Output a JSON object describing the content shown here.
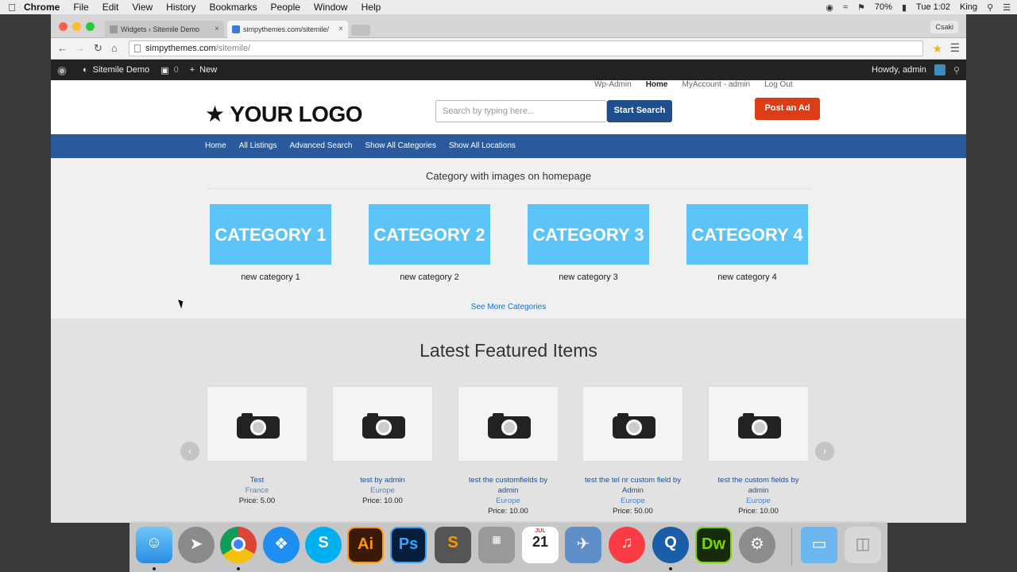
{
  "menubar": {
    "app": "Chrome",
    "items": [
      "File",
      "Edit",
      "View",
      "History",
      "Bookmarks",
      "People",
      "Window",
      "Help"
    ],
    "battery": "70%",
    "clock": "Tue 1:02",
    "user": "King"
  },
  "browser": {
    "tabs": [
      {
        "title": "Widgets ‹ Sitemile Demo",
        "active": false
      },
      {
        "title": "simpythemes.com/sitemile/",
        "active": true
      }
    ],
    "profile": "Csaki",
    "url_host": "simpythemes.com",
    "url_path": "/sitemile/"
  },
  "adminbar": {
    "site": "Sitemile Demo",
    "comments": "0",
    "new": "New",
    "howdy": "Howdy, admin"
  },
  "site": {
    "toplinks": [
      "Wp-Admin",
      "Home",
      "MyAccount - admin",
      "Log Out"
    ],
    "logo": "YOUR LOGO",
    "search_placeholder": "Search by typing here...",
    "search_button": "Start Search",
    "post_button": "Post an Ad",
    "nav": [
      "Home",
      "All Listings",
      "Advanced Search",
      "Show All Categories",
      "Show All Locations"
    ]
  },
  "categories": {
    "title": "Category with images on homepage",
    "items": [
      {
        "image_text": "CATEGORY 1",
        "label": "new category 1"
      },
      {
        "image_text": "CATEGORY 2",
        "label": "new category 2"
      },
      {
        "image_text": "CATEGORY 3",
        "label": "new category 3"
      },
      {
        "image_text": "CATEGORY 4",
        "label": "new category 4"
      }
    ],
    "see_more": "See More Categories"
  },
  "featured": {
    "title": "Latest Featured Items",
    "items": [
      {
        "name": "Test",
        "location": "France",
        "price": "Price: 5.00"
      },
      {
        "name": "test by admin",
        "location": "Europe",
        "price": "Price: 10.00"
      },
      {
        "name": "test the customfields by admin",
        "location": "Europe",
        "price": "Price: 10.00"
      },
      {
        "name": "test the tel nr custom field by Admin",
        "location": "Europe",
        "price": "Price: 50.00"
      },
      {
        "name": "test the custom fields by admin",
        "location": "Europe",
        "price": "Price: 10.00"
      }
    ]
  },
  "dock": {
    "apps": [
      "finder-icon",
      "launchpad-icon",
      "chrome-icon",
      "safari-icon",
      "skype-icon",
      "illustrator-icon",
      "photoshop-icon",
      "sublime-icon",
      "calculator-icon",
      "calendar-icon",
      "preview-icon",
      "itunes-icon",
      "quicktime-icon",
      "dreamweaver-icon",
      "system-preferences-icon",
      "folder-icon",
      "trash-icon"
    ],
    "illustrator": "Ai",
    "photoshop": "Ps",
    "dreamweaver": "Dw",
    "skype": "S",
    "sublime": "S",
    "calendar_month": "JUL",
    "calendar_day": "21"
  }
}
